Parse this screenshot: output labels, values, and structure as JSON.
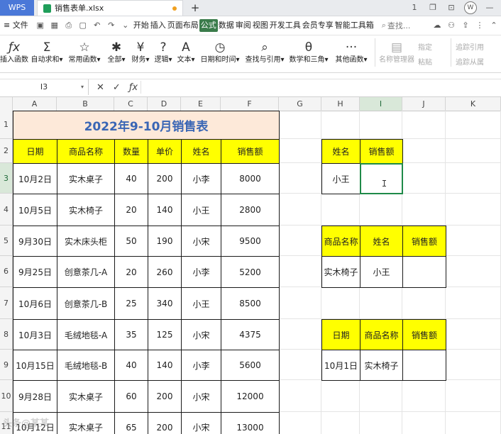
{
  "titlebar": {
    "app_tab": "WPS",
    "file_name": "销售表单.xlsx",
    "new_tab": "+",
    "win_buttons": [
      "1",
      "❐",
      "⊡",
      "W",
      "—"
    ]
  },
  "menubar": {
    "file_menu": "≡ 文件",
    "items": [
      "开始",
      "插入",
      "页面布局",
      "公式",
      "数据",
      "审阅",
      "视图",
      "开发工具",
      "会员专享",
      "智能工具箱"
    ],
    "active_index": 3,
    "search_label": "查找..."
  },
  "ribbon": {
    "buttons": [
      {
        "icon": "ƒx",
        "label": "插入函数",
        "disabled": false
      },
      {
        "icon": "Σ",
        "label": "自动求和▾",
        "disabled": false
      },
      {
        "icon": "☆",
        "label": "常用函数▾",
        "disabled": false
      },
      {
        "icon": "✱",
        "label": "全部▾",
        "disabled": false
      },
      {
        "icon": "¥",
        "label": "财务▾",
        "disabled": false
      },
      {
        "icon": "?",
        "label": "逻辑▾",
        "disabled": false
      },
      {
        "icon": "A",
        "label": "文本▾",
        "disabled": false
      },
      {
        "icon": "◷",
        "label": "日期和时间▾",
        "disabled": false
      },
      {
        "icon": "⌕",
        "label": "查找与引用▾",
        "disabled": false
      },
      {
        "icon": "θ",
        "label": "数学和三角▾",
        "disabled": false
      },
      {
        "icon": "···",
        "label": "其他函数▾",
        "disabled": false
      },
      {
        "icon": "▤",
        "label": "名称管理器",
        "disabled": true
      }
    ],
    "small_buttons": [
      "指定",
      "粘贴"
    ],
    "trace_buttons": [
      "追踪引用",
      "追踪从属"
    ]
  },
  "formula_bar": {
    "cell_ref": "I3",
    "icons": [
      "✕",
      "✓",
      "ƒx"
    ],
    "value": ""
  },
  "sheet": {
    "columns": [
      "A",
      "B",
      "C",
      "D",
      "E",
      "F",
      "G",
      "H",
      "I",
      "J",
      "K"
    ],
    "selected_column": "I",
    "rows": [
      "1",
      "2",
      "3",
      "4",
      "5",
      "6",
      "7",
      "8",
      "9",
      "10",
      "11"
    ],
    "selected_row": "3",
    "title": "2022年9-10月销售表",
    "headers": [
      "日期",
      "商品名称",
      "数量",
      "单价",
      "姓名",
      "销售额"
    ],
    "data": [
      [
        "10月2日",
        "实木桌子",
        "40",
        "200",
        "小李",
        "8000"
      ],
      [
        "10月5日",
        "实木椅子",
        "20",
        "140",
        "小王",
        "2800"
      ],
      [
        "9月30日",
        "实木床头柜",
        "50",
        "190",
        "小宋",
        "9500"
      ],
      [
        "9月25日",
        "创意茶几-A",
        "20",
        "260",
        "小李",
        "5200"
      ],
      [
        "10月6日",
        "创意茶几-B",
        "25",
        "340",
        "小王",
        "8500"
      ],
      [
        "10月3日",
        "毛绒地毯-A",
        "35",
        "125",
        "小宋",
        "4375"
      ],
      [
        "10月15日",
        "毛绒地毯-B",
        "40",
        "140",
        "小李",
        "5600"
      ],
      [
        "9月28日",
        "实木桌子",
        "60",
        "200",
        "小宋",
        "12000"
      ],
      [
        "10月12日",
        "实木桌子",
        "65",
        "200",
        "小宋",
        "13000"
      ]
    ],
    "lookup1": {
      "headers": [
        "姓名",
        "销售额"
      ],
      "values": [
        "小王",
        ""
      ]
    },
    "lookup2": {
      "headers": [
        "商品名称",
        "姓名",
        "销售额"
      ],
      "values": [
        "实木椅子",
        "小王",
        ""
      ]
    },
    "lookup3": {
      "headers": [
        "日期",
        "商品名称",
        "销售额"
      ],
      "values": [
        "10月1日",
        "实木椅子",
        ""
      ]
    }
  },
  "watermark": "头条@某某"
}
